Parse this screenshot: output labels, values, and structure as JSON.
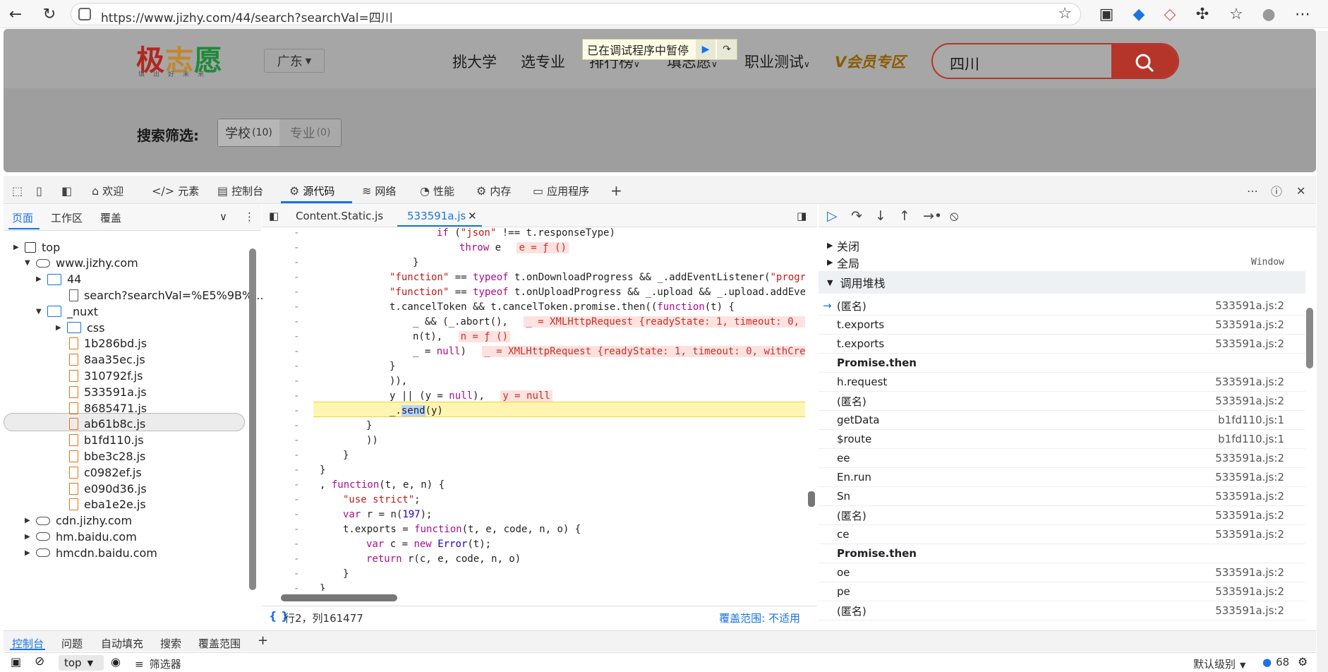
{
  "browser": {
    "url": "https://www.jizhy.com/44/search?searchVal=四川"
  },
  "site": {
    "logo_chars": [
      "极",
      "志",
      "愿"
    ],
    "logo_sub": "填出好未来",
    "region": "广东",
    "nav": [
      "挑大学",
      "选专业",
      "排行榜",
      "填志愿",
      "职业测试"
    ],
    "vip": "V会员专区",
    "search_value": "四川",
    "debug_banner": "已在调试程序中暂停",
    "filter_label": "搜索筛选:",
    "filter_tabs": [
      {
        "label": "学校",
        "count": "(10)"
      },
      {
        "label": "专业",
        "count": "(0)"
      }
    ]
  },
  "devtools": {
    "tabs": [
      "欢迎",
      "元素",
      "控制台",
      "源代码",
      "网络",
      "性能",
      "内存",
      "应用程序"
    ],
    "left_tabs": [
      "页面",
      "工作区",
      "覆盖"
    ],
    "tree": [
      {
        "label": "top",
        "depth": 0,
        "type": "frame",
        "arrow": "▶"
      },
      {
        "label": "www.jizhy.com",
        "depth": 1,
        "type": "cloud",
        "arrow": "▼"
      },
      {
        "label": "44",
        "depth": 2,
        "type": "folder",
        "arrow": "▶"
      },
      {
        "label": "search?searchVal=%E5%9B%...",
        "depth": 3,
        "type": "doc",
        "arrow": ""
      },
      {
        "label": "_nuxt",
        "depth": 2,
        "type": "folder",
        "arrow": "▼"
      },
      {
        "label": "css",
        "depth": 3,
        "type": "folder",
        "arrow": "▶"
      },
      {
        "label": "1b286bd.js",
        "depth": 3,
        "type": "js",
        "arrow": ""
      },
      {
        "label": "8aa35ec.js",
        "depth": 3,
        "type": "js",
        "arrow": ""
      },
      {
        "label": "310792f.js",
        "depth": 3,
        "type": "js",
        "arrow": ""
      },
      {
        "label": "533591a.js",
        "depth": 3,
        "type": "js",
        "arrow": ""
      },
      {
        "label": "8685471.js",
        "depth": 3,
        "type": "js",
        "arrow": ""
      },
      {
        "label": "ab61b8c.js",
        "depth": 3,
        "type": "js",
        "arrow": ""
      },
      {
        "label": "b1fd110.js",
        "depth": 3,
        "type": "js",
        "arrow": ""
      },
      {
        "label": "bbe3c28.js",
        "depth": 3,
        "type": "js",
        "arrow": ""
      },
      {
        "label": "c0982ef.js",
        "depth": 3,
        "type": "js",
        "arrow": ""
      },
      {
        "label": "e090d36.js",
        "depth": 3,
        "type": "js",
        "arrow": ""
      },
      {
        "label": "eba1e2e.js",
        "depth": 3,
        "type": "js",
        "arrow": ""
      },
      {
        "label": "cdn.jizhy.com",
        "depth": 1,
        "type": "cloud",
        "arrow": "▶"
      },
      {
        "label": "hm.baidu.com",
        "depth": 1,
        "type": "cloud",
        "arrow": "▶"
      },
      {
        "label": "hmcdn.baidu.com",
        "depth": 1,
        "type": "cloud",
        "arrow": "▶"
      }
    ],
    "editor_tabs": [
      "Content.Static.js",
      "533591a.js"
    ],
    "status_pos": "行2，列161477",
    "status_cov": "覆盖范围: 不适用",
    "scope": {
      "closure": "关闭",
      "global": "全局",
      "global_val": "Window"
    },
    "stack_title": "调用堆栈",
    "stack": [
      {
        "name": "(匿名)",
        "loc": "533591a.js:2",
        "current": true
      },
      {
        "name": "t.exports",
        "loc": "533591a.js:2"
      },
      {
        "name": "t.exports",
        "loc": "533591a.js:2"
      },
      {
        "name": "Promise.then",
        "loc": "",
        "bold": true
      },
      {
        "name": "h.request",
        "loc": "533591a.js:2"
      },
      {
        "name": "(匿名)",
        "loc": "533591a.js:2"
      },
      {
        "name": "getData",
        "loc": "b1fd110.js:1"
      },
      {
        "name": "$route",
        "loc": "b1fd110.js:1"
      },
      {
        "name": "ee",
        "loc": "533591a.js:2"
      },
      {
        "name": "En.run",
        "loc": "533591a.js:2"
      },
      {
        "name": "Sn",
        "loc": "533591a.js:2"
      },
      {
        "name": "(匿名)",
        "loc": "533591a.js:2"
      },
      {
        "name": "ce",
        "loc": "533591a.js:2"
      },
      {
        "name": "Promise.then",
        "loc": "",
        "bold": true
      },
      {
        "name": "oe",
        "loc": "533591a.js:2"
      },
      {
        "name": "pe",
        "loc": "533591a.js:2"
      },
      {
        "name": "(匿名)",
        "loc": "533591a.js:2"
      }
    ],
    "drawer_tabs": [
      "控制台",
      "问题",
      "自动填充",
      "搜索",
      "覆盖范围"
    ],
    "console": {
      "context": "top",
      "filter": "筛选器",
      "level": "默认级别",
      "count": "68"
    }
  }
}
